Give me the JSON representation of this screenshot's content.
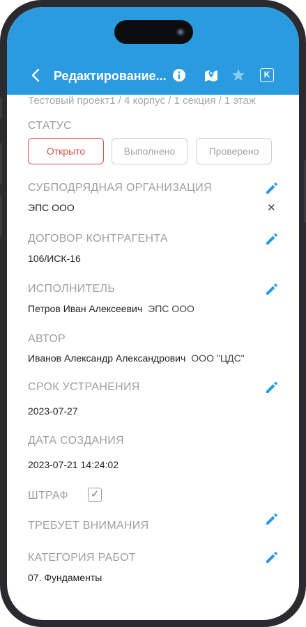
{
  "header": {
    "title": "Редактирование...",
    "icons": [
      "back-chevron-icon",
      "info-icon",
      "map-icon",
      "star-icon",
      "k-badge-icon"
    ],
    "k_badge": "K",
    "background": "#2b9be0"
  },
  "breadcrumb": "Тестовый проект1 / 4 корпус / 1 секция / 1 этаж",
  "status": {
    "label": "СТАТУС",
    "options": [
      "Открыто",
      "Выполнено",
      "Проверено"
    ],
    "selected": "Открыто",
    "selected_color": "#d9534f"
  },
  "fields": {
    "subcontractor": {
      "label": "СУБПОДРЯДНАЯ ОРГАНИЗАЦИЯ",
      "value": "ЭПС ООО"
    },
    "contract": {
      "label": "ДОГОВОР КОНТРАГЕНТА",
      "value": "106/ИСК-16"
    },
    "executor": {
      "label": "ИСПОЛНИТЕЛЬ",
      "value": "Петров Иван Алексеевич",
      "org": "ЭПС ООО"
    },
    "author": {
      "label": "АВТОР",
      "value": "Иванов Александр Александрович",
      "org": "ООО \"ЦДС\""
    },
    "deadline": {
      "label": "СРОК УСТРАНЕНИЯ",
      "value": "2023-07-27"
    },
    "created": {
      "label": "ДАТА СОЗДАНИЯ",
      "value": "2023-07-21 14:24:02"
    },
    "penalty": {
      "label": "ШТРАФ",
      "checked": true
    },
    "attention": {
      "label": "ТРЕБУЕТ ВНИМАНИЯ"
    },
    "work_category": {
      "label": "КАТЕГОРИЯ РАБОТ",
      "value": "07. Фундаменты"
    }
  },
  "accent_color": "#2b9be0"
}
